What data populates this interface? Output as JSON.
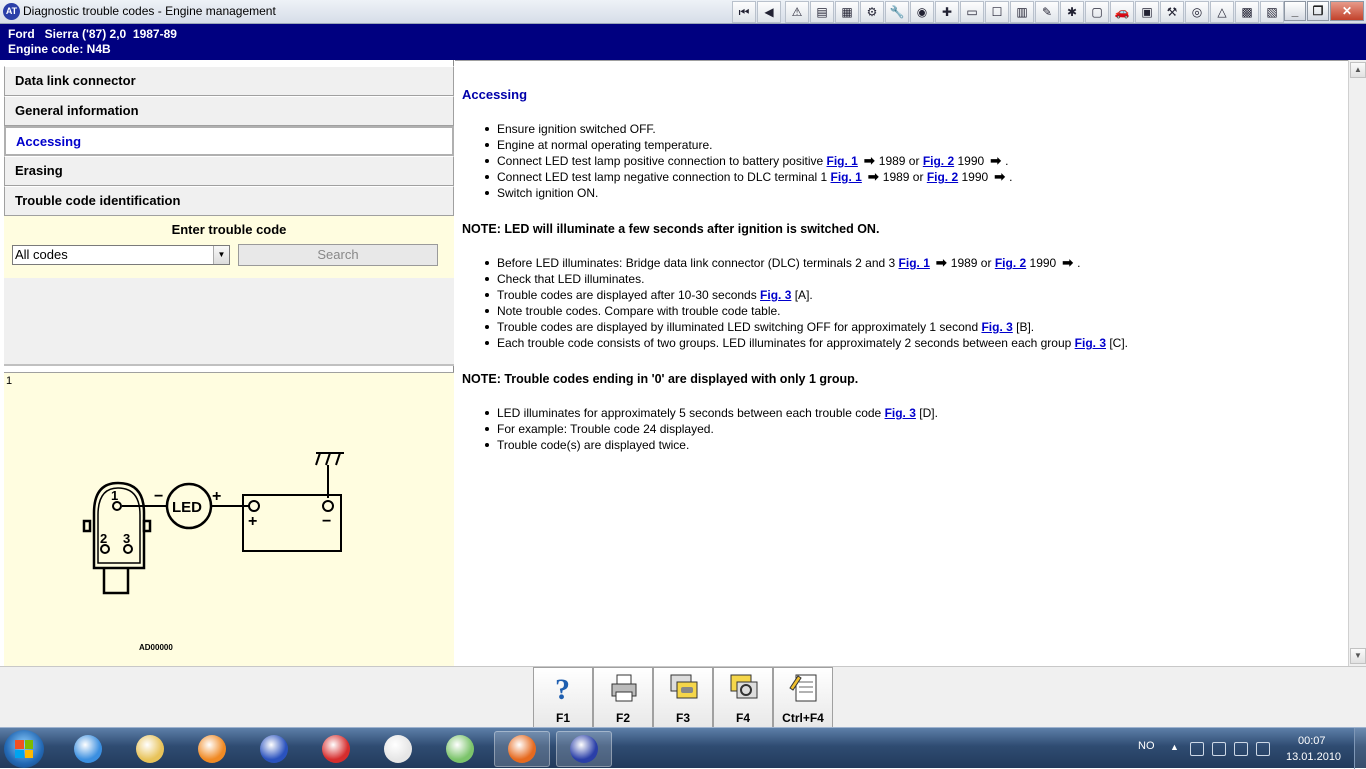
{
  "window": {
    "title": "Diagnostic trouble codes - Engine management",
    "app_icon_label": "AT"
  },
  "toolbar": {
    "buttons": [
      "first-page-icon",
      "previous-page-icon",
      "warning-icon",
      "document-icon",
      "chart-icon",
      "gear-icon",
      "wrench-icon",
      "gauge-icon",
      "component-icon",
      "battery-icon",
      "check-icon",
      "lift-icon",
      "tool-icon",
      "bug-icon",
      "page-icon",
      "car-icon",
      "camera-icon",
      "service-icon",
      "tyre-icon",
      "triangle-icon",
      "van-icon",
      "note-icon"
    ],
    "glyphs": [
      "⏮",
      "◀",
      "⚠",
      "▤",
      "▦",
      "⚙",
      "🔧",
      "◉",
      "✚",
      "▭",
      "☐",
      "▥",
      "✎",
      "✱",
      "▢",
      "🚗",
      "▣",
      "⚒",
      "◎",
      "△",
      "▩",
      "▧"
    ]
  },
  "window_controls": {
    "minimize": "_",
    "maximize": "❐",
    "close": "✕"
  },
  "vehicle": {
    "line1": "Ford   Sierra ('87) 2,0  1987-89",
    "line2": "Engine code: N4B"
  },
  "nav": {
    "items": [
      {
        "label": "Data link connector",
        "active": false
      },
      {
        "label": "General information",
        "active": false
      },
      {
        "label": "Accessing",
        "active": true
      },
      {
        "label": "Erasing",
        "active": false
      },
      {
        "label": "Trouble code identification",
        "active": false
      }
    ]
  },
  "search": {
    "title": "Enter trouble code",
    "selected": "All codes",
    "button_label": "Search"
  },
  "figure": {
    "number": "1",
    "led_label": "LED",
    "pin1": "1",
    "pin2": "2",
    "pin3": "3",
    "minus": "−",
    "plus": "+",
    "reference": "AD00000"
  },
  "content": {
    "heading": "Accessing",
    "block1": [
      {
        "text": "Ensure ignition switched OFF."
      },
      {
        "text": "Engine at normal operating temperature."
      },
      {
        "text": "Connect LED test lamp positive connection to battery positive ",
        "fig_a": "Fig. 1",
        "year_a": "1989 or",
        "fig_b": "Fig. 2",
        "year_b": "1990",
        "end": "."
      },
      {
        "text": "Connect LED test lamp negative connection to DLC terminal 1 ",
        "fig_a": "Fig. 1",
        "year_a": "1989 or",
        "fig_b": "Fig. 2",
        "year_b": "1990",
        "end": "."
      },
      {
        "text": "Switch ignition ON."
      }
    ],
    "note1": "NOTE: LED will illuminate a few seconds after ignition is switched ON.",
    "block2": [
      {
        "text": "Before LED illuminates: Bridge data link connector (DLC) terminals 2 and 3 ",
        "fig_a": "Fig. 1",
        "year_a": "1989 or",
        "fig_b": "Fig. 2",
        "year_b": "1990",
        "end": "."
      },
      {
        "text": "Check that LED illuminates."
      },
      {
        "text": "Trouble codes are displayed after 10-30 seconds ",
        "fig": "Fig. 3",
        "suffix": " [A]."
      },
      {
        "text": "Note trouble codes. Compare with trouble code table."
      },
      {
        "text": "Trouble codes are displayed by illuminated LED switching OFF for approximately 1 second ",
        "fig": "Fig. 3",
        "suffix": " [B]."
      },
      {
        "text": "Each trouble code consists of two groups. LED illuminates for approximately 2 seconds between each group ",
        "fig": "Fig. 3",
        "suffix": " [C]."
      }
    ],
    "note2": "NOTE: Trouble codes ending in '0' are displayed with only 1 group.",
    "block3": [
      {
        "text": "LED illuminates for approximately 5 seconds between each trouble code ",
        "fig": "Fig. 3",
        "suffix": " [D]."
      },
      {
        "text": "For example: Trouble code 24 displayed."
      },
      {
        "text": "Trouble code(s) are displayed twice."
      }
    ],
    "arrow_glyph": "➡"
  },
  "function_keys": [
    {
      "label": "F1",
      "icon": "help-icon"
    },
    {
      "label": "F2",
      "icon": "printer-icon"
    },
    {
      "label": "F3",
      "icon": "cars-icon"
    },
    {
      "label": "F4",
      "icon": "cars-search-icon"
    },
    {
      "label": "Ctrl+F4",
      "icon": "notepad-icon"
    }
  ],
  "taskbar": {
    "apps": [
      {
        "icon": "ie-icon",
        "color": "#3b8fe0",
        "open": false
      },
      {
        "icon": "folder-icon",
        "color": "#e8c35a",
        "open": false
      },
      {
        "icon": "media-player-icon",
        "color": "#f08a24",
        "open": false
      },
      {
        "icon": "user-icon",
        "color": "#2a52be",
        "open": false
      },
      {
        "icon": "pin-icon",
        "color": "#d62d2d",
        "open": false
      },
      {
        "icon": "clock-icon",
        "color": "#e6e6e6",
        "open": false
      },
      {
        "icon": "people-icon",
        "color": "#7cc46b",
        "open": false
      },
      {
        "icon": "firefox-icon",
        "color": "#e66a1f",
        "open": true
      },
      {
        "icon": "app-icon",
        "color": "#2a3fa8",
        "open": true
      }
    ],
    "language": "NO",
    "time": "00:07",
    "date": "13.01.2010"
  }
}
